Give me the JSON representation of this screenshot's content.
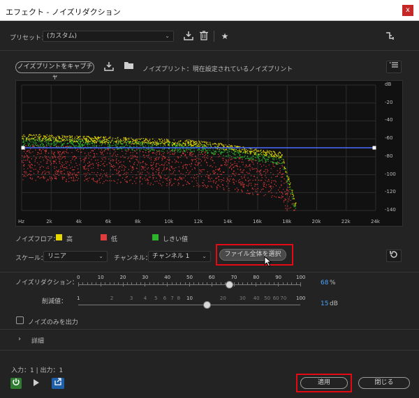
{
  "window": {
    "title": "エフェクト - ノイズリダクション",
    "close_label": "x"
  },
  "preset": {
    "label": "プリセット：",
    "value": "(カスタム)"
  },
  "capture": {
    "button_label": "ノイズプリントをキャプチャ",
    "status_text": "ノイズプリント：現在設定されているノイズプリント"
  },
  "graph": {
    "db_labels": [
      "dB",
      "-20",
      "-40",
      "-60",
      "-80",
      "-100",
      "-120",
      "-140"
    ],
    "freq_labels": [
      "Hz",
      "2k",
      "4k",
      "6k",
      "8k",
      "10k",
      "12k",
      "14k",
      "16k",
      "18k",
      "20k",
      "22k",
      "24k"
    ]
  },
  "legend": {
    "label": "ノイズフロア：",
    "high": "高",
    "low": "低",
    "threshold": "しきい値",
    "colors": {
      "high": "#e6d800",
      "low": "#e23b3b",
      "threshold": "#2bb52b"
    }
  },
  "scale": {
    "label": "スケール：",
    "value": "リニア"
  },
  "channel": {
    "label": "チャンネル：",
    "value": "チャンネル 1"
  },
  "select_all_button": "ファイル全体を選択",
  "noise_reduction": {
    "label": "ノイズリダクション：",
    "scale": [
      "0",
      "10",
      "20",
      "30",
      "40",
      "50",
      "60",
      "70",
      "80",
      "90",
      "100"
    ],
    "value": "68",
    "unit": "%",
    "level": 0.68
  },
  "reduce_by": {
    "label": "削減値：",
    "scale": [
      "1",
      "2",
      "3",
      "4",
      "5",
      "6",
      "7",
      "8",
      "10",
      "20",
      "30",
      "40",
      "50",
      "60",
      "70",
      "100"
    ],
    "value": "15",
    "unit": "dB"
  },
  "output_noise_only": {
    "label": "ノイズのみを出力"
  },
  "advanced": {
    "label": "詳細"
  },
  "io_text": "入力：1 | 出力：1",
  "buttons": {
    "apply": "適用",
    "close": "閉じる"
  }
}
